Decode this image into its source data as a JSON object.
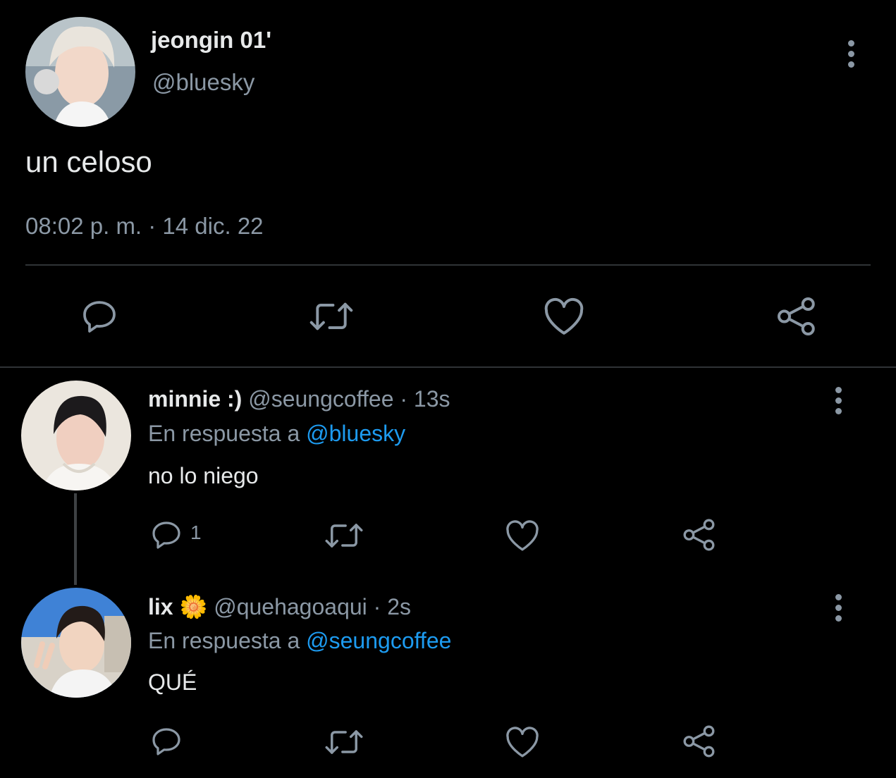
{
  "main_tweet": {
    "display_name": "jeongin 01'",
    "handle": "@bluesky",
    "text": "un celoso",
    "timestamp": "08:02 p. m. · 14 dic. 22"
  },
  "replies": [
    {
      "display_name": "minnie :)",
      "handle": "@seungcoffee",
      "time": "· 13s",
      "reply_prefix": "En respuesta a",
      "reply_to": "@bluesky",
      "text": "no lo niego",
      "reply_count": "1"
    },
    {
      "display_name": "lix",
      "emoji": "🌼",
      "handle": "@quehagoaqui",
      "time": "· 2s",
      "reply_prefix": "En respuesta a",
      "reply_to": "@seungcoffee",
      "text": "QUÉ",
      "reply_count": ""
    }
  ],
  "icons": {
    "reply": "speech-bubble-icon",
    "retweet": "retweet-icon",
    "like": "heart-icon",
    "share": "share-icon",
    "more": "more-options-icon"
  },
  "colors": {
    "background": "#000000",
    "text": "#e7e9ea",
    "muted": "#8b98a5",
    "link": "#1d9bf0",
    "divider": "#2f3336"
  }
}
